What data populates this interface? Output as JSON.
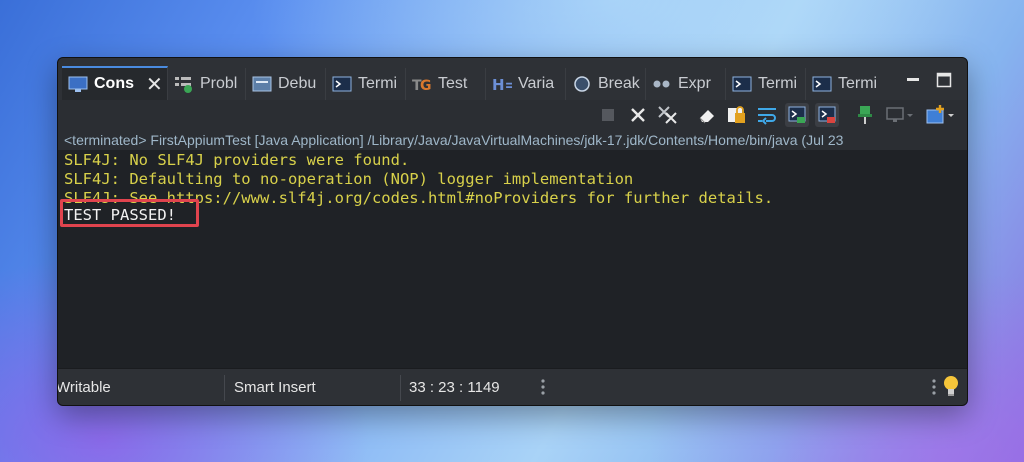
{
  "tabs": [
    {
      "label": "Cons",
      "icon": "console-icon",
      "active": true
    },
    {
      "label": "Probl",
      "icon": "problems-icon"
    },
    {
      "label": "Debu",
      "icon": "debug-icon"
    },
    {
      "label": "Termi",
      "icon": "terminal-icon"
    },
    {
      "label": "Test",
      "icon": "testng-icon"
    },
    {
      "label": "Varia",
      "icon": "variables-icon"
    },
    {
      "label": "Break",
      "icon": "breakpoints-icon"
    },
    {
      "label": "Expr",
      "icon": "expressions-icon"
    },
    {
      "label": "Termi",
      "icon": "terminal-icon"
    },
    {
      "label": "Termi",
      "icon": "terminal-icon"
    }
  ],
  "tab_close_glyph": "✕",
  "window_controls": {
    "minimize": "▭",
    "maximize": "□"
  },
  "toolbar_icons": [
    "terminate-icon",
    "remove-launch-icon",
    "remove-all-terminated-icon",
    "clear-console-icon",
    "scroll-lock-icon",
    "word-wrap-icon",
    "show-on-stdout-icon",
    "show-on-stderr-icon",
    "pin-console-icon",
    "display-selected-console-icon",
    "open-console-icon"
  ],
  "launch_info": "<terminated> FirstAppiumTest [Java Application] /Library/Java/JavaVirtualMachines/jdk-17.jdk/Contents/Home/bin/java  (Jul 23",
  "console_lines": [
    {
      "text": "SLF4J: No SLF4J providers were found.",
      "type": "warn"
    },
    {
      "text": "SLF4J: Defaulting to no-operation (NOP) logger implementation",
      "type": "warn"
    },
    {
      "text": "SLF4J: See https://www.slf4j.org/codes.html#noProviders for further details.",
      "type": "warn"
    },
    {
      "text": "TEST PASSED!",
      "type": "out"
    }
  ],
  "highlight_color": "#e0444e",
  "status": {
    "writable": "Writable",
    "insert_mode": "Smart Insert",
    "position": "33 : 23 : 1149"
  },
  "colors": {
    "warning_text": "#d8d14a",
    "output_text": "#f2f2f2",
    "background": "#1f2226"
  }
}
